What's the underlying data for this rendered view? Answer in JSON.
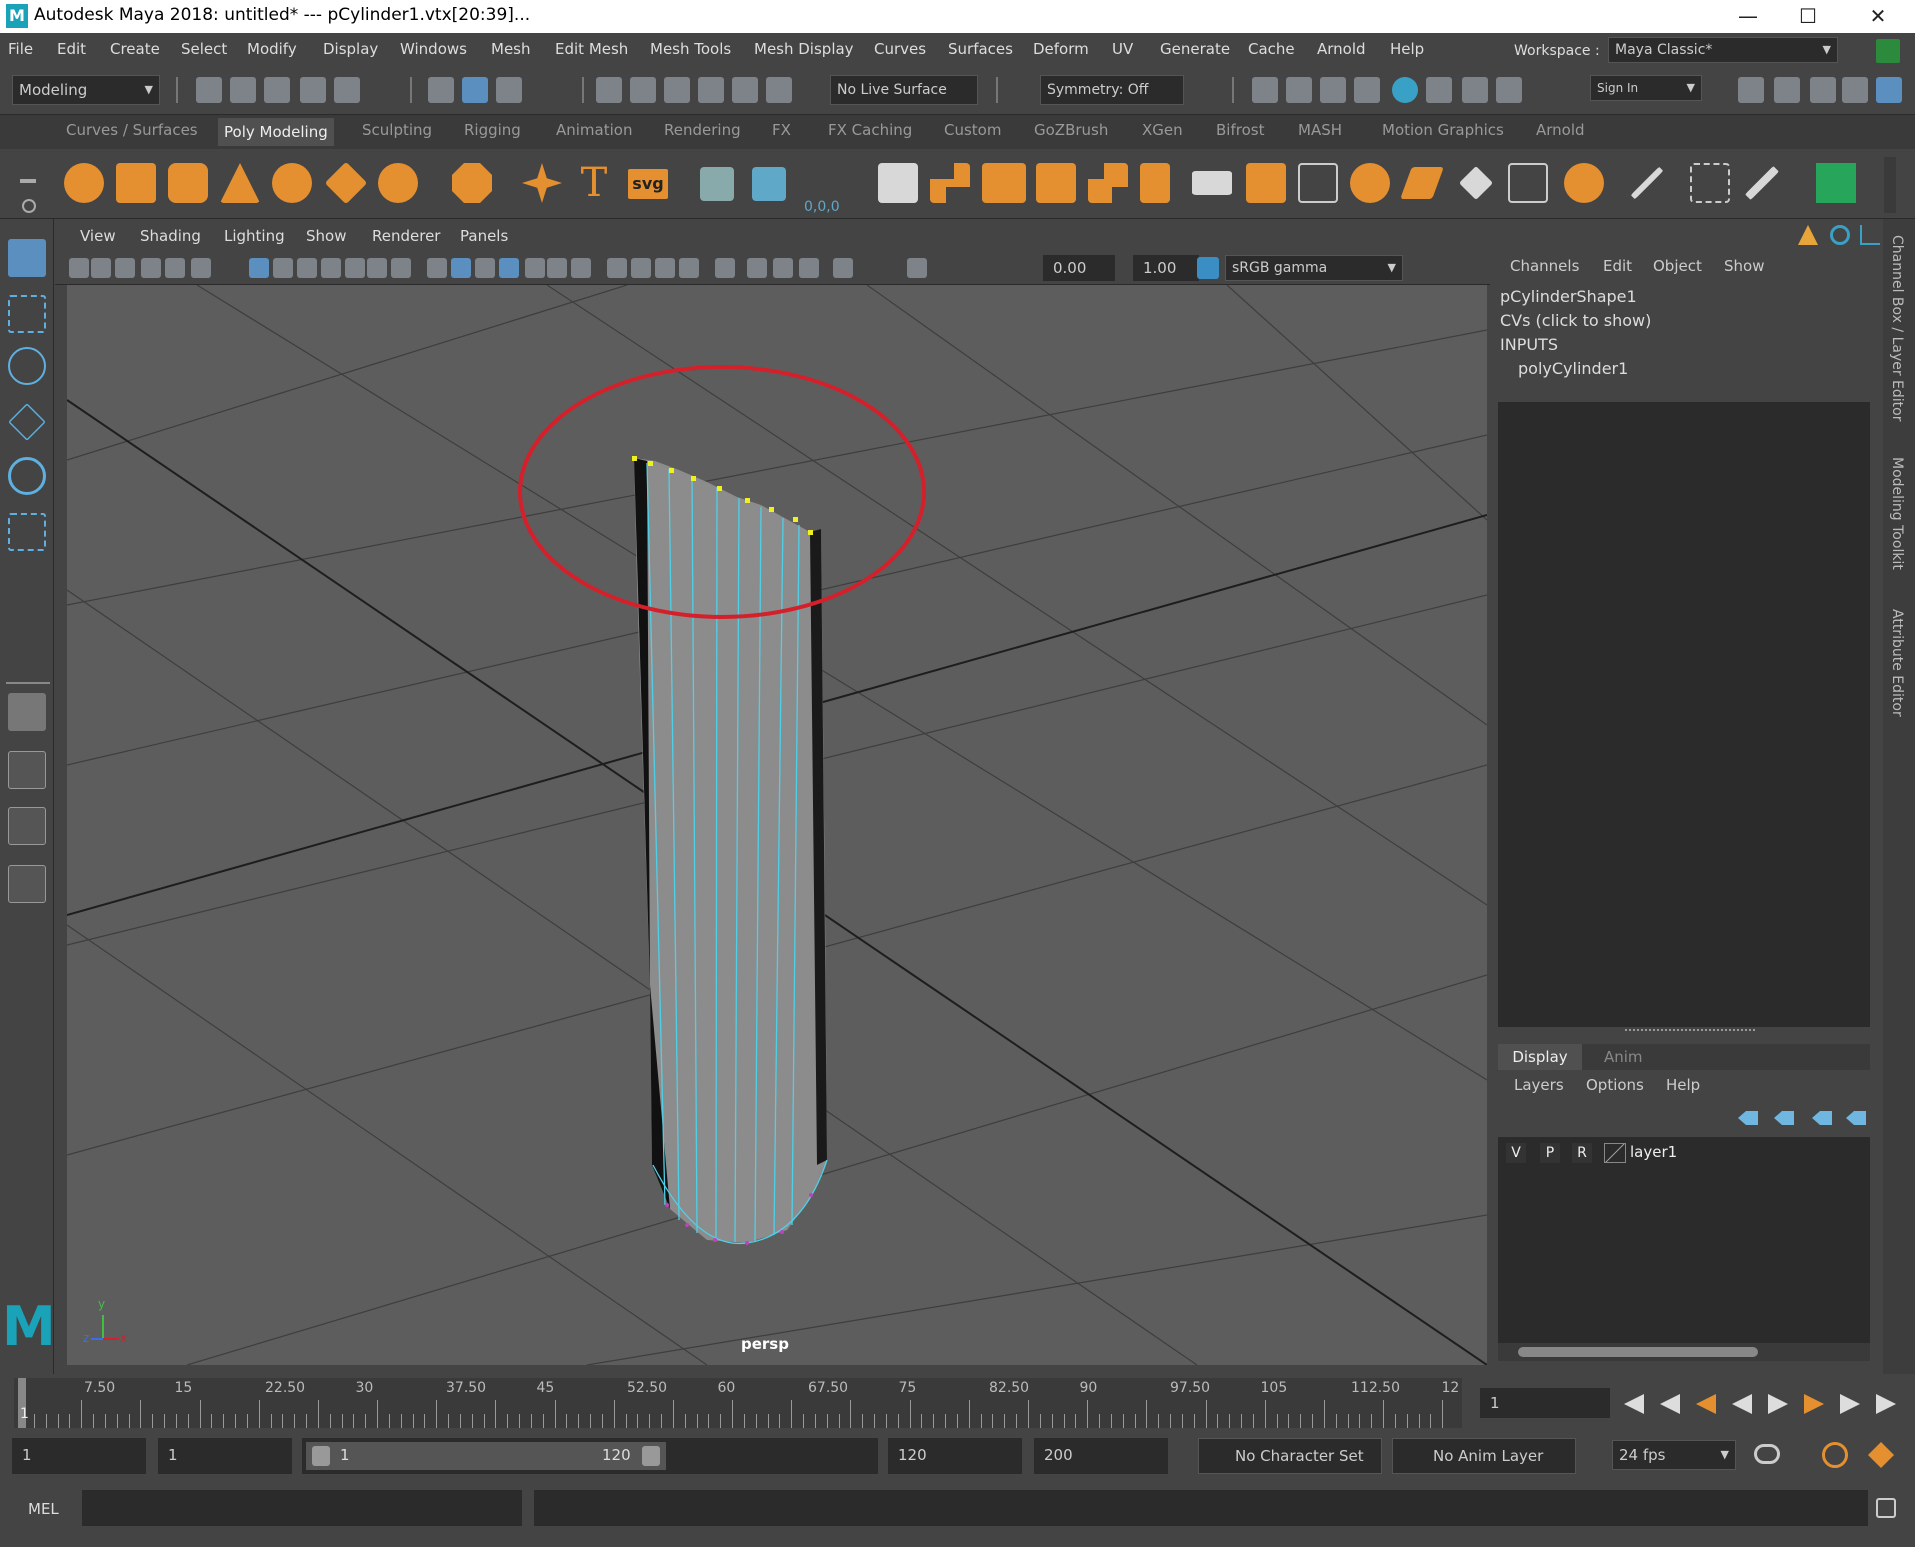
{
  "window": {
    "title": "Autodesk Maya 2018: untitled*    ---    pCylinder1.vtx[20:39]...",
    "minimize": "—",
    "maximize": "☐",
    "close": "✕"
  },
  "menubar": {
    "items": [
      "File",
      "Edit",
      "Create",
      "Select",
      "Modify",
      "Display",
      "Windows",
      "Mesh",
      "Edit Mesh",
      "Mesh Tools",
      "Mesh Display",
      "Curves",
      "Surfaces",
      "Deform",
      "UV",
      "Generate",
      "Cache",
      "Arnold",
      "Help"
    ],
    "workspace_label": "Workspace :",
    "workspace_value": "Maya Classic*"
  },
  "statusline": {
    "menuset": "Modeling",
    "live_surface": "No Live Surface",
    "symmetry": "Symmetry: Off",
    "sign_in": "Sign In"
  },
  "shelf": {
    "tabs": [
      "Curves / Surfaces",
      "Poly Modeling",
      "Sculpting",
      "Rigging",
      "Animation",
      "Rendering",
      "FX",
      "FX Caching",
      "Custom",
      "GoZBrush",
      "XGen",
      "Bifrost",
      "MASH",
      "Motion Graphics",
      "Arnold"
    ],
    "active_tab": "Poly Modeling",
    "text_icon": "T",
    "svg_icon": "svg",
    "sweep_label": "0,0,0"
  },
  "viewport": {
    "menus": [
      "View",
      "Shading",
      "Lighting",
      "Show",
      "Renderer",
      "Panels"
    ],
    "exposure": "0.00",
    "gamma": "1.00",
    "colorspace": "sRGB gamma",
    "camera_label": "persp",
    "axis_y": "y",
    "axis_z": "z",
    "axis_x": "x",
    "logo": "M"
  },
  "channelbox": {
    "menus": [
      "Channels",
      "Edit",
      "Object",
      "Show"
    ],
    "shape": "pCylinderShape1",
    "cvs": "CVs (click to show)",
    "inputs": "INPUTS",
    "input_node": "polyCylinder1"
  },
  "layereditor": {
    "tabs": [
      "Display",
      "Anim"
    ],
    "active_tab": "Display",
    "menus": [
      "Layers",
      "Options",
      "Help"
    ],
    "layer": {
      "v": "V",
      "p": "P",
      "r": "R",
      "name": "layer1"
    }
  },
  "side_tabs": [
    "Channel Box / Layer Editor",
    "Modeling Toolkit",
    "Attribute Editor"
  ],
  "timeline": {
    "ticks": [
      "7.50",
      "15",
      "22.50",
      "30",
      "37.50",
      "45",
      "52.50",
      "60",
      "67.50",
      "75",
      "82.50",
      "90",
      "97.50",
      "105",
      "112.50",
      "12"
    ],
    "current_marker": "1",
    "current_frame": "1"
  },
  "range": {
    "start": "1",
    "anim_start": "1",
    "slider_start": "1",
    "slider_end": "120",
    "end": "120",
    "anim_end": "200",
    "character_set": "No Character Set",
    "anim_layer": "No Anim Layer",
    "fps": "24 fps"
  },
  "cmdline": {
    "label": "MEL"
  },
  "colors": {
    "accent": "#5a8fbf",
    "shelf_orange": "#e59030",
    "selection_red": "#d4202a",
    "vertex_yellow": "#f0f020",
    "wire_cyan": "#4fd0e8"
  }
}
